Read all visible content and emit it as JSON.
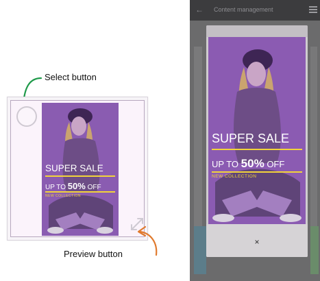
{
  "annotations": {
    "select_label": "Select button",
    "preview_label": "Preview button"
  },
  "poster": {
    "headline": "SUPER SALE",
    "offer_prefix": "UP TO",
    "offer_value": "50%",
    "offer_suffix": "OFF",
    "tagline": "NEW COLLECTION"
  },
  "phone": {
    "title": "Content management",
    "close_symbol": "×"
  },
  "icons": {
    "select": "select-circle-icon",
    "preview": "expand-arrows-icon",
    "back": "back-arrow-icon",
    "menu": "hamburger-menu-icon",
    "close": "close-icon"
  },
  "colors": {
    "annotation_arrow_select": "#1f9a4a",
    "annotation_arrow_preview": "#e07a2e",
    "poster_purple": "#8b5bb2",
    "sale_accent": "#f2d43a",
    "phone_dark": "#3c3c3e"
  }
}
